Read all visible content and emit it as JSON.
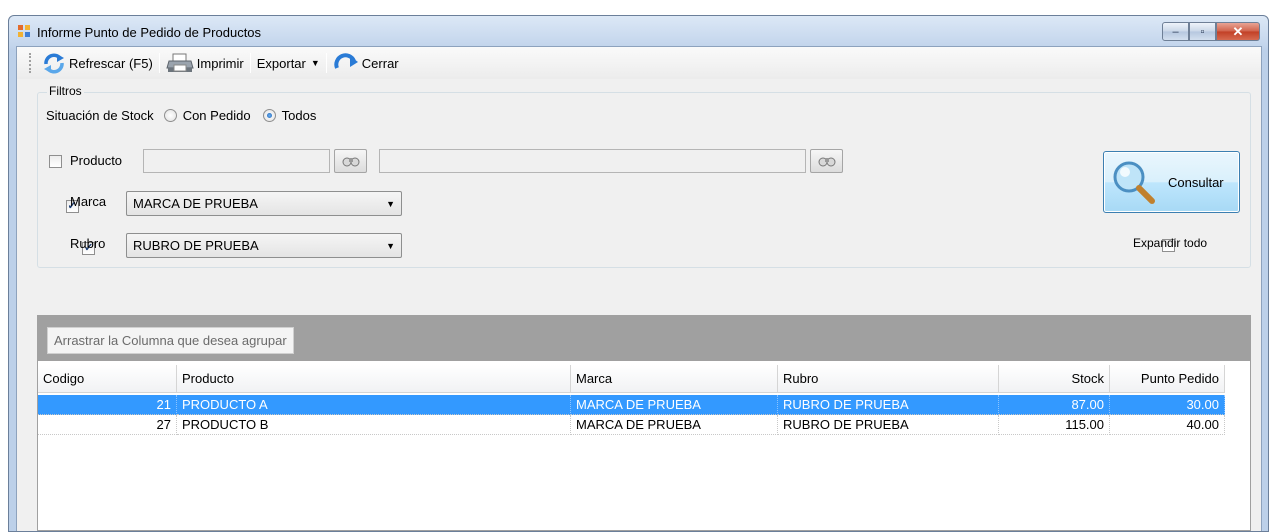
{
  "window": {
    "title": "Informe Punto de Pedido de Productos",
    "controls": {
      "minimize": "–",
      "maximize": "▫",
      "close": "✕"
    }
  },
  "toolbar": {
    "refresh_label": "Refrescar (F5)",
    "print_label": "Imprimir",
    "export_label": "Exportar",
    "close_label": "Cerrar"
  },
  "filters": {
    "group_title": "Filtros",
    "stock_label": "Situación de Stock",
    "radio_con_pedido": "Con Pedido",
    "radio_todos": "Todos",
    "stock_selected": "Todos",
    "producto_label": "Producto",
    "producto_checked": false,
    "producto_code": "",
    "producto_desc": "",
    "marca_label": "Marca",
    "marca_checked": true,
    "marca_value": "MARCA DE PRUEBA",
    "rubro_label": "Rubro",
    "rubro_checked": true,
    "rubro_value": "RUBRO DE PRUEBA",
    "consultar_label": "Consultar",
    "expandir_label": "Expandir todo",
    "expandir_checked": false
  },
  "grid": {
    "group_hint": "Arrastrar la Columna que desea agrupar",
    "columns": [
      "Codigo",
      "Producto",
      "Marca",
      "Rubro",
      "Stock",
      "Punto Pedido"
    ],
    "rows": [
      {
        "codigo": "21",
        "producto": "PRODUCTO A",
        "marca": "MARCA DE PRUEBA",
        "rubro": "RUBRO DE PRUEBA",
        "stock": "87.00",
        "punto_pedido": "30.00",
        "selected": true
      },
      {
        "codigo": "27",
        "producto": "PRODUCTO B",
        "marca": "MARCA DE PRUEBA",
        "rubro": "RUBRO DE PRUEBA",
        "stock": "115.00",
        "punto_pedido": "40.00",
        "selected": false
      }
    ]
  },
  "colors": {
    "selection": "#3399ff",
    "group_area": "#a0a0a0",
    "client_bg": "#f0f0f0"
  }
}
